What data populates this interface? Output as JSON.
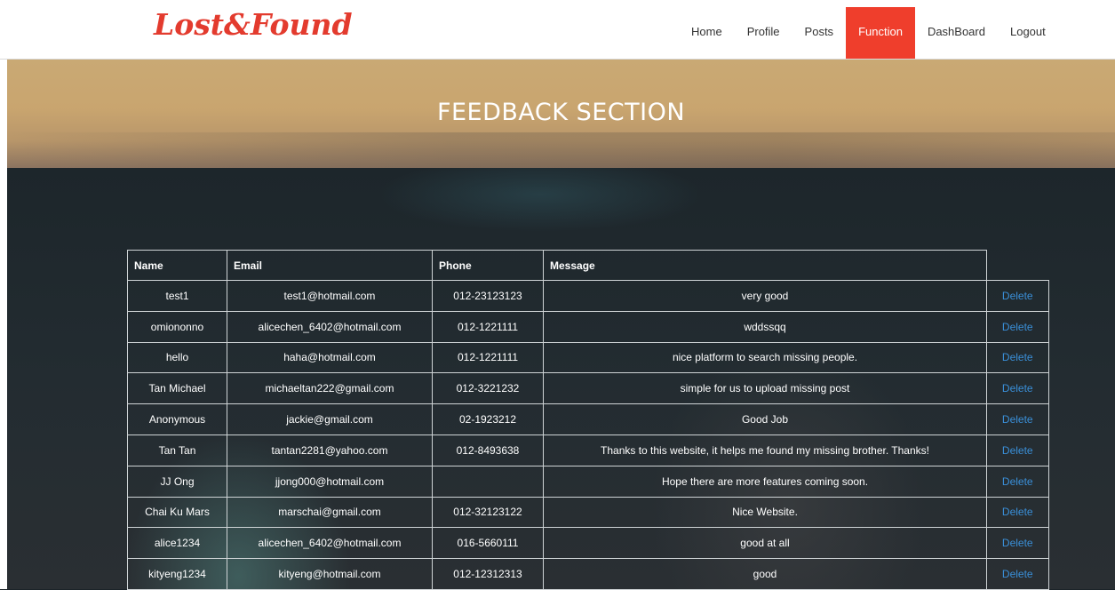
{
  "brand": "Lost&Found",
  "nav": {
    "items": [
      "Home",
      "Profile",
      "Posts",
      "Function",
      "DashBoard",
      "Logout"
    ],
    "active": "Function"
  },
  "banner": {
    "title": "FEEDBACK SECTION"
  },
  "table": {
    "headers": [
      "Name",
      "Email",
      "Phone",
      "Message"
    ],
    "action_label": "Delete",
    "rows": [
      {
        "name": "test1",
        "email": "test1@hotmail.com",
        "phone": "012-23123123",
        "message": "very good"
      },
      {
        "name": "omiononno",
        "email": "alicechen_6402@hotmail.com",
        "phone": "012-1221111",
        "message": "wddssqq"
      },
      {
        "name": "hello",
        "email": "haha@hotmail.com",
        "phone": "012-1221111",
        "message": "nice platform to search missing people."
      },
      {
        "name": "Tan Michael",
        "email": "michaeltan222@gmail.com",
        "phone": "012-3221232",
        "message": "simple for us to upload missing post"
      },
      {
        "name": "Anonymous",
        "email": "jackie@gmail.com",
        "phone": "02-1923212",
        "message": "Good Job"
      },
      {
        "name": "Tan Tan",
        "email": "tantan2281@yahoo.com",
        "phone": "012-8493638",
        "message": "Thanks to this website, it helps me found my missing brother. Thanks!"
      },
      {
        "name": "JJ Ong",
        "email": "jjong000@hotmail.com",
        "phone": "",
        "message": "Hope there are more features coming soon."
      },
      {
        "name": "Chai Ku Mars",
        "email": "marschai@gmail.com",
        "phone": "012-32123122",
        "message": "Nice Website."
      },
      {
        "name": "alice1234",
        "email": "alicechen_6402@hotmail.com",
        "phone": "016-5660111",
        "message": "good at all"
      },
      {
        "name": "kityeng1234",
        "email": "kityeng@hotmail.com",
        "phone": "012-12312313",
        "message": "good"
      }
    ]
  },
  "colors": {
    "brand": "#e33b2e",
    "active_nav": "#ef3e2c",
    "link": "#3a8fd8"
  }
}
